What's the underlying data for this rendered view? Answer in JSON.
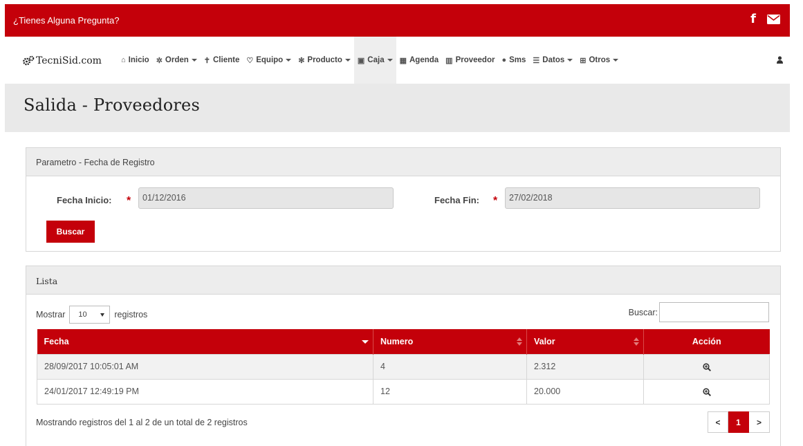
{
  "colors": {
    "brand_red": "#c4000a",
    "header_gray": "#e9e9e9"
  },
  "topbar": {
    "question": "¿Tienes Alguna Pregunta?",
    "icons": [
      "facebook-icon",
      "mail-icon"
    ]
  },
  "navbar": {
    "brand": "TecniSid.com",
    "items": [
      {
        "label": "Inicio",
        "icon": "home-icon"
      },
      {
        "label": "Orden",
        "icon": "gear-icon"
      },
      {
        "label": "Cliente",
        "icon": "person-icon"
      },
      {
        "label": "Equipo",
        "icon": "lightbulb-icon"
      },
      {
        "label": "Producto",
        "icon": "gears-icon"
      },
      {
        "label": "Caja",
        "icon": "money-icon"
      },
      {
        "label": "Agenda",
        "icon": "calendar-icon"
      },
      {
        "label": "Proveedor",
        "icon": "building-icon"
      },
      {
        "label": "Sms",
        "icon": "chat-icon"
      },
      {
        "label": "Datos",
        "icon": "list-icon"
      },
      {
        "label": "Otros",
        "icon": "sitemap-icon"
      }
    ],
    "user_icon": "user-icon"
  },
  "page": {
    "title": "Salida - Proveedores"
  },
  "filters": {
    "panel_title": "Parametro - Fecha de Registro",
    "start_label": "Fecha Inicio:",
    "start_value": "01/12/2016",
    "end_label": "Fecha Fin:",
    "end_value": "27/02/2018",
    "required_mark": "*",
    "search_button": "Buscar"
  },
  "list": {
    "panel_title": "Lista",
    "show_label": "Mostrar",
    "page_length": "10",
    "records_label": "registros",
    "search_label": "Buscar:",
    "columns": [
      "Fecha",
      "Numero",
      "Valor",
      "Acción"
    ],
    "rows": [
      {
        "fecha": "28/09/2017 10:05:01 AM",
        "numero": "4",
        "valor": "2.312"
      },
      {
        "fecha": "24/01/2017 12:49:19 PM",
        "numero": "12",
        "valor": "20.000"
      }
    ],
    "info": "Mostrando registros del 1 al 2 de un total de 2 registros",
    "pager": {
      "prev": "<",
      "current": "1",
      "next": ">"
    }
  }
}
